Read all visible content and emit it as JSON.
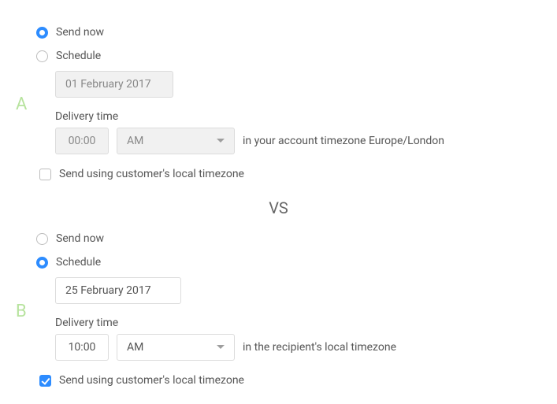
{
  "variant_a": {
    "letter": "A",
    "send_now_label": "Send now",
    "schedule_label": "Schedule",
    "date_value": "01 February 2017",
    "delivery_time_label": "Delivery time",
    "time_value": "00:00",
    "ampm_value": "AM",
    "timezone_note": "in your account timezone Europe/London",
    "local_tz_label": "Send using customer's local timezone"
  },
  "vs_label": "VS",
  "variant_b": {
    "letter": "B",
    "send_now_label": "Send now",
    "schedule_label": "Schedule",
    "date_value": "25 February 2017",
    "delivery_time_label": "Delivery time",
    "time_value": "10:00",
    "ampm_value": "AM",
    "timezone_note": "in the recipient's local timezone",
    "local_tz_label": "Send using customer's local timezone"
  }
}
